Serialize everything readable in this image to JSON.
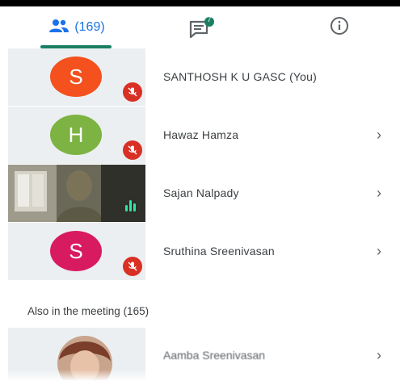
{
  "tabs": {
    "people_count": "(169)",
    "chat_badge": "7"
  },
  "participants": [
    {
      "initial": "S",
      "name": "SANTHOSH K U GASC (You)",
      "avatar_color": "#f4511e",
      "muted": true,
      "has_video": false,
      "chevron": false
    },
    {
      "initial": "H",
      "name": "Hawaz Hamza",
      "avatar_color": "#7cb342",
      "muted": true,
      "has_video": false,
      "chevron": true
    },
    {
      "initial": "",
      "name": "Sajan Nalpady",
      "avatar_color": "",
      "muted": false,
      "has_video": true,
      "chevron": true
    },
    {
      "initial": "S",
      "name": "Sruthina Sreenivasan",
      "avatar_color": "#d81b60",
      "muted": true,
      "has_video": false,
      "chevron": true
    }
  ],
  "also_in_meeting": {
    "label": "Also in the meeting (165)",
    "first_name": "Aamba Sreenivasan"
  },
  "icons": {
    "people": "people-icon",
    "chat": "chat-icon",
    "info": "info-icon",
    "mic_off": "mic-off-icon",
    "chevron": "chevron-right-icon"
  },
  "colors": {
    "accent": "#1a73e8",
    "tab_underline": "#1a7f64",
    "mic_off": "#d93025",
    "speaking": "#2ee6a8"
  }
}
